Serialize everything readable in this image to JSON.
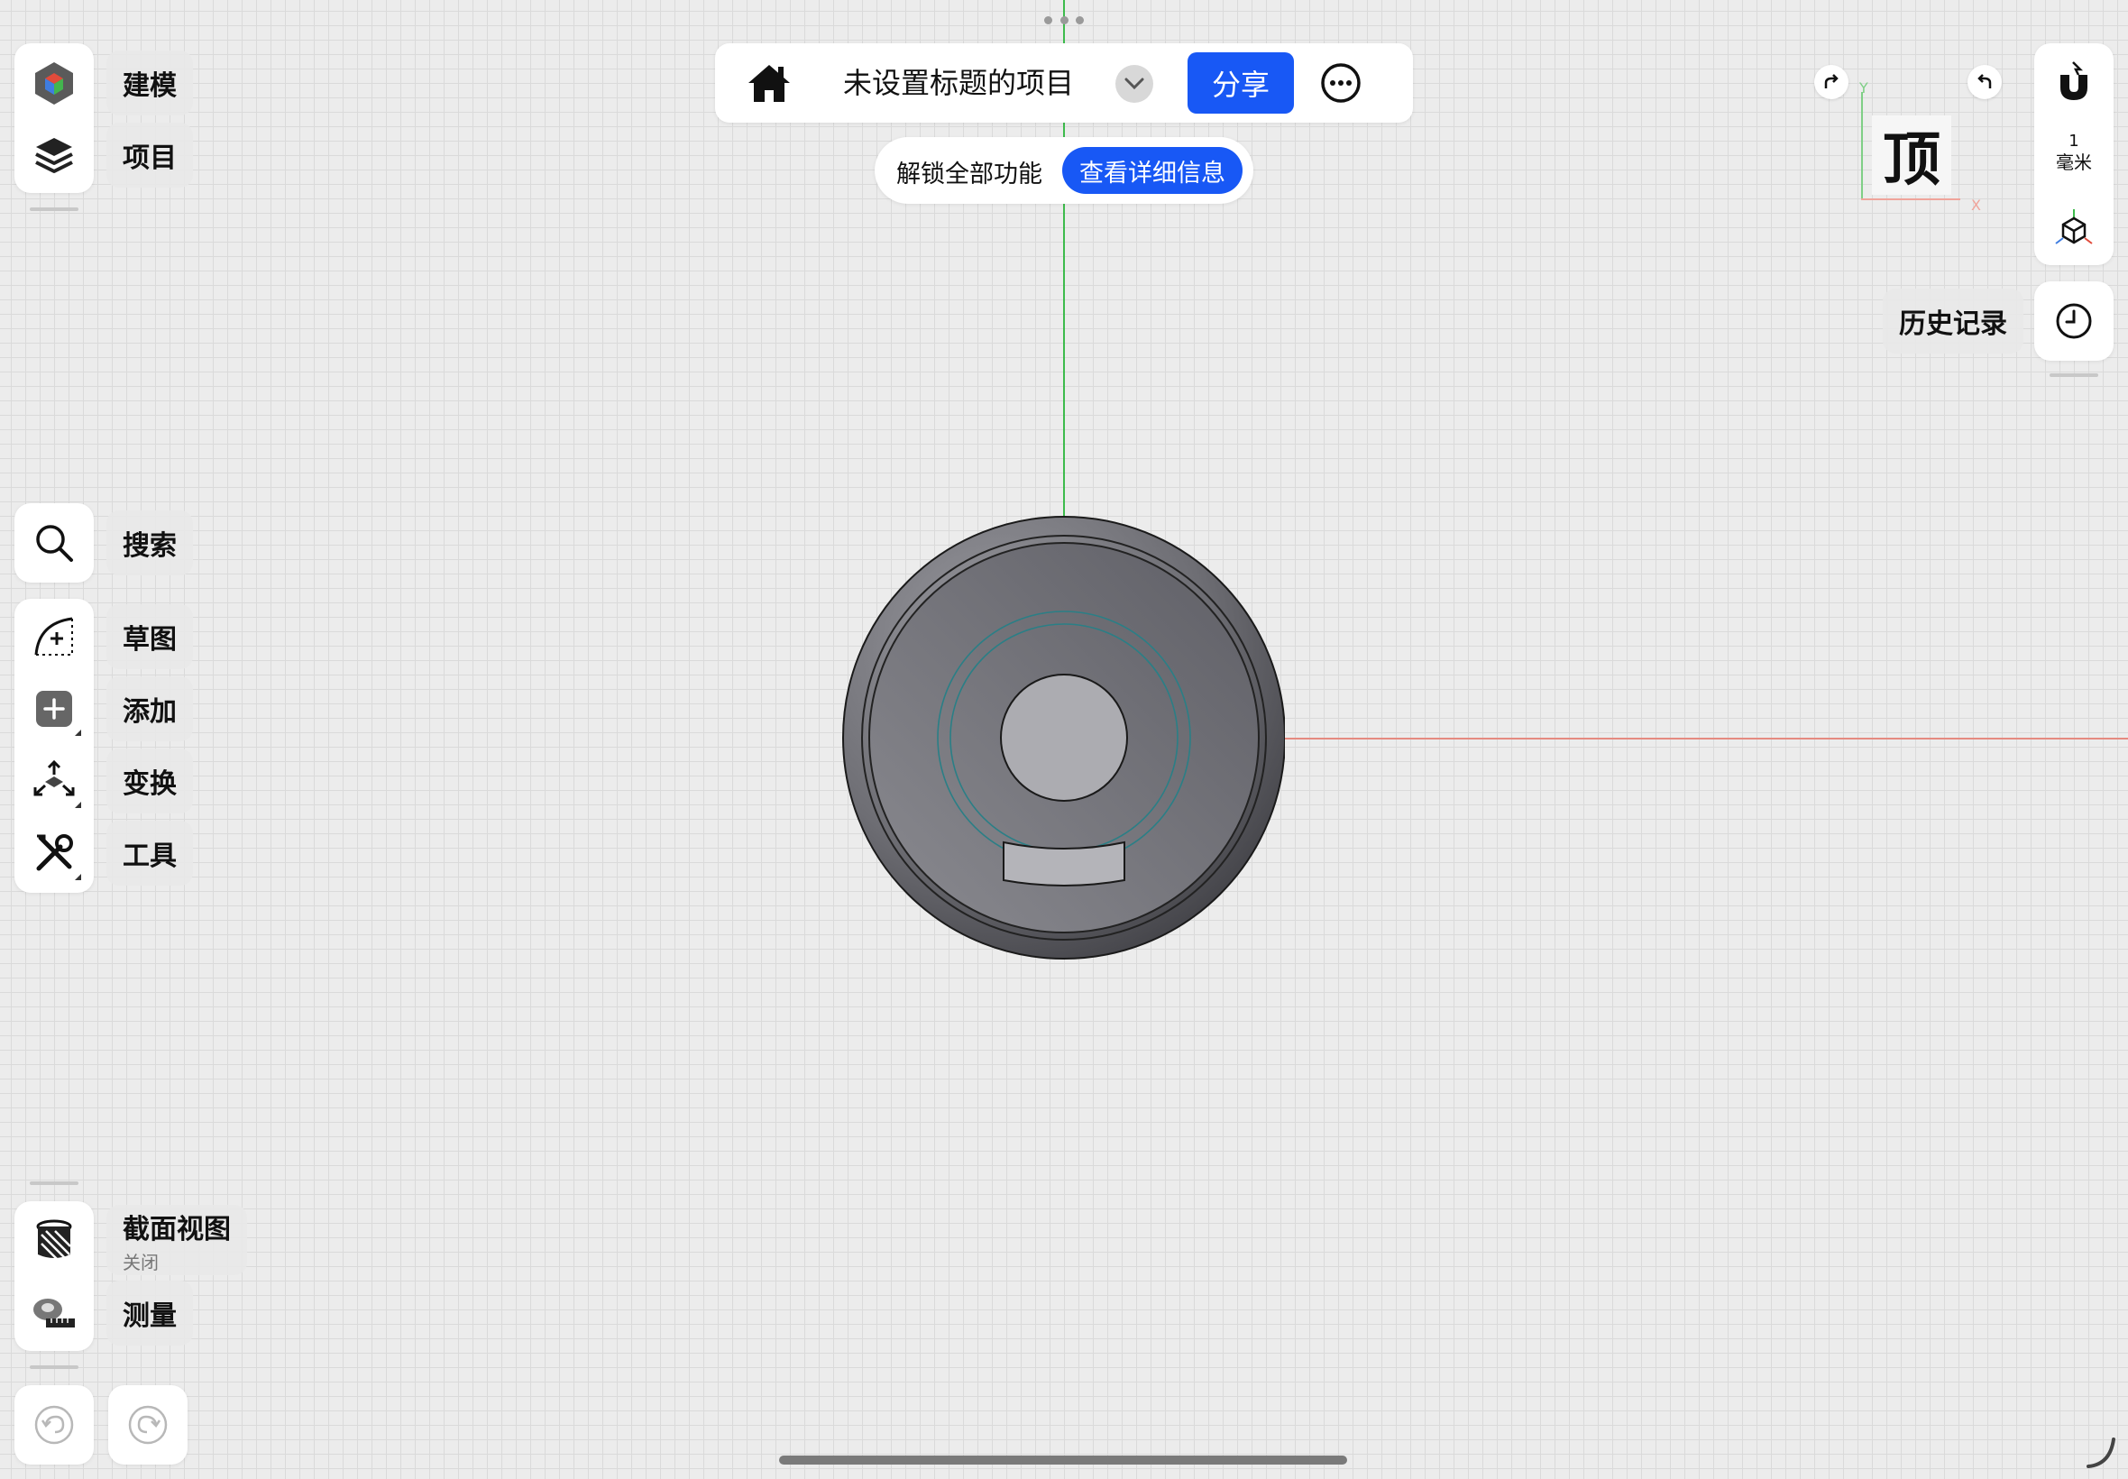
{
  "topbar": {
    "title": "未设置标题的项目",
    "share_label": "分享"
  },
  "unlock": {
    "text": "解锁全部功能",
    "button": "查看详细信息"
  },
  "left_top": {
    "items": [
      {
        "label": "建模"
      },
      {
        "label": "项目"
      }
    ]
  },
  "search": {
    "label": "搜索"
  },
  "tools": {
    "items": [
      {
        "label": "草图"
      },
      {
        "label": "添加"
      },
      {
        "label": "变换"
      },
      {
        "label": "工具"
      }
    ]
  },
  "bottom": {
    "section_label": "截面视图",
    "section_sub": "关闭",
    "measure_label": "测量"
  },
  "viewcube": {
    "face": "顶",
    "axis_y": "Y",
    "axis_x": "X"
  },
  "right": {
    "grid_value": "1",
    "grid_unit": "毫米",
    "history_label": "历史记录"
  },
  "colors": {
    "accent": "#1858f5",
    "axis_y": "#3dbb4c",
    "axis_x": "#e58a80"
  }
}
